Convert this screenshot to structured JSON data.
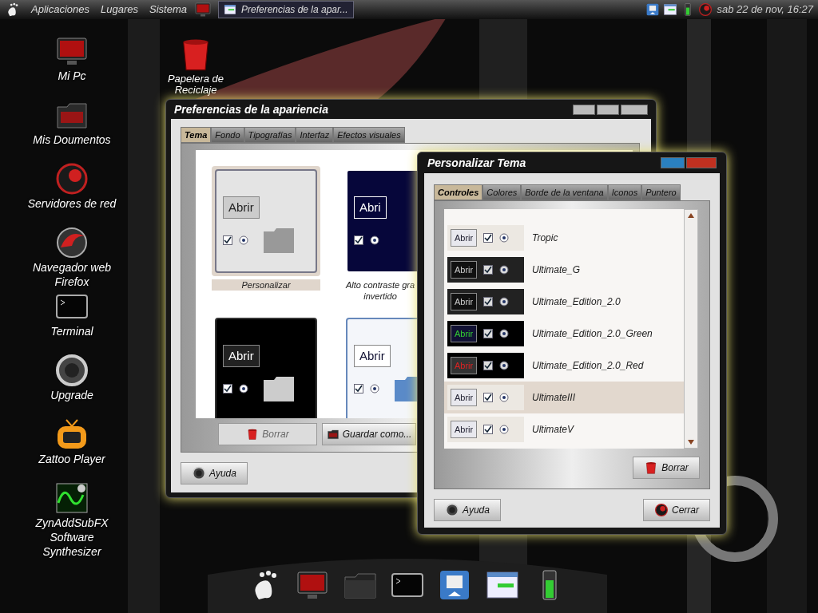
{
  "top_panel": {
    "menus": [
      "Aplicaciones",
      "Lugares",
      "Sistema"
    ],
    "task": {
      "label": "Preferencias de la apar...",
      "selected": true
    },
    "clock": "sab 22 de nov, 16:27"
  },
  "desktop_icons": [
    {
      "kind": "monitor",
      "lines": [
        "Mi Pc"
      ]
    },
    {
      "kind": "documents",
      "lines": [
        "Mis Doumentos"
      ]
    },
    {
      "kind": "network",
      "lines": [
        "Servidores de red"
      ]
    },
    {
      "kind": "browser",
      "lines": [
        "Navegador web",
        "Firefox"
      ]
    },
    {
      "kind": "terminal",
      "lines": [
        "Terminal"
      ]
    },
    {
      "kind": "upgrade",
      "lines": [
        "Upgrade"
      ]
    },
    {
      "kind": "tv",
      "lines": [
        "Zattoo Player"
      ]
    },
    {
      "kind": "synth",
      "lines": [
        "ZynAddSubFX",
        "Software",
        "Synthesizer"
      ]
    }
  ],
  "trash": {
    "lines": [
      "Papelera de",
      "Reciclaje"
    ]
  },
  "appearance_window": {
    "title": "Preferencias de la apariencia",
    "tabs": [
      {
        "label": "Tema",
        "selected": true
      },
      {
        "label": "Fondo",
        "selected": false
      },
      {
        "label": "Tipografías",
        "selected": false
      },
      {
        "label": "Interfaz",
        "selected": false
      },
      {
        "label": "Efectos visuales",
        "selected": false
      }
    ],
    "themes": [
      {
        "kind": "light",
        "button_label": "Abrir",
        "lines": [
          "Personalizar"
        ],
        "selected": true
      },
      {
        "kind": "contrast",
        "button_label": "Abri",
        "lines": [
          "Alto contraste gra",
          "invertido"
        ],
        "selected": false
      },
      {
        "kind": "dark",
        "button_label": "Abrir",
        "selected": false
      },
      {
        "kind": "blue",
        "button_label": "Abrir",
        "selected": false
      }
    ],
    "buttons": [
      {
        "kind": "delete",
        "label": "Borrar",
        "disabled": true
      },
      {
        "kind": "save",
        "label": "Guardar como...",
        "disabled": false
      }
    ],
    "help": "Ayuda"
  },
  "customize_window": {
    "title": "Personalizar Tema",
    "tabs": [
      {
        "label": "Controles",
        "selected": true
      },
      {
        "label": "Colores",
        "selected": false
      },
      {
        "label": "Borde de la ventana",
        "selected": false
      },
      {
        "label": "Iconos",
        "selected": false
      },
      {
        "label": "Puntero",
        "selected": false
      }
    ],
    "themes": [
      {
        "kind": "light",
        "button_label": "Abrir",
        "name": "Tropic",
        "selected": false
      },
      {
        "kind": "dark",
        "button_label": "Abrir",
        "name": "Ultimate_G",
        "selected": false
      },
      {
        "kind": "dark",
        "button_label": "Abrir",
        "name": "Ultimate_Edition_2.0",
        "selected": false
      },
      {
        "kind": "green",
        "button_label": "Abrir",
        "name": "Ultimate_Edition_2.0_Green",
        "selected": false
      },
      {
        "kind": "red",
        "button_label": "Abrir",
        "name": "Ultimate_Edition_2.0_Red",
        "selected": false
      },
      {
        "kind": "light",
        "button_label": "Abrir",
        "name": "UltimateIII",
        "selected": true
      },
      {
        "kind": "light",
        "button_label": "Abrir",
        "name": "UltimateV",
        "selected": false
      }
    ],
    "delete": "Borrar",
    "help": "Ayuda",
    "close": "Cerrar"
  }
}
